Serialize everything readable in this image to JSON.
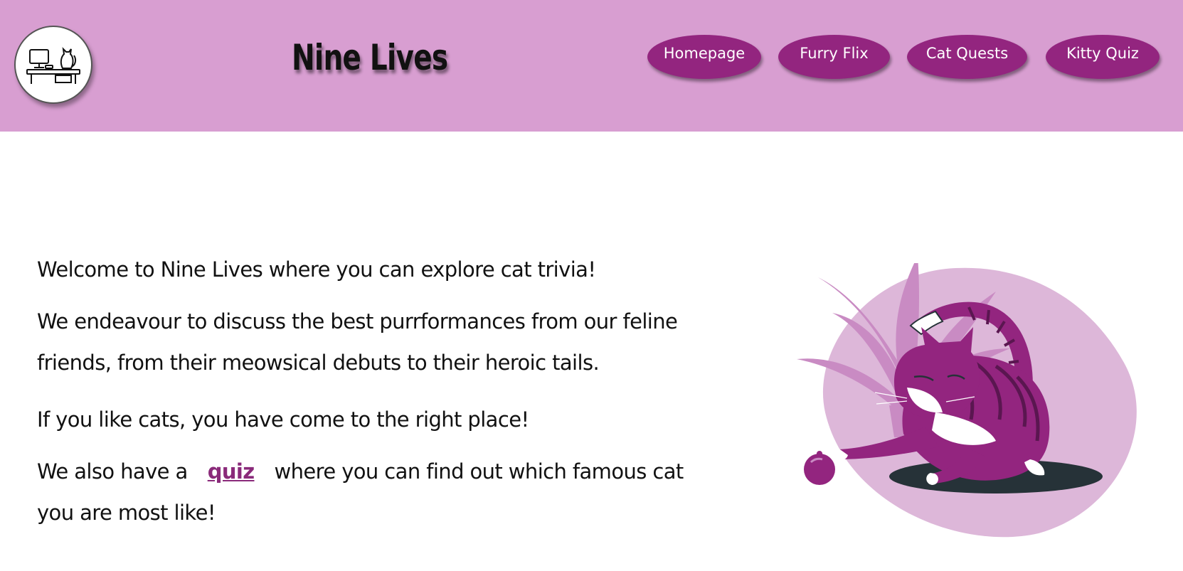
{
  "site": {
    "title": "Nine Lives"
  },
  "nav": [
    {
      "label": "Homepage"
    },
    {
      "label": "Furry Flix"
    },
    {
      "label": "Cat Quests"
    },
    {
      "label": "Kitty Quiz"
    }
  ],
  "main": {
    "welcome": "Welcome to Nine Lives where you can explore cat trivia!",
    "intro": "We endeavour to discuss the best purrformances from our feline friends, from their meowsical debuts to their heroic tails.",
    "cta": "If you like cats, you have come to the right place!",
    "quiz_prefix": "We also have a",
    "quiz_link": "quiz",
    "quiz_suffix": "where you can find out which famous cat you are most like!"
  },
  "colors": {
    "header_bg": "#d89ed1",
    "nav_bg": "#93257f",
    "accent": "#8a2a7a"
  },
  "icons": {
    "logo": "cat-at-desk-icon",
    "hero": "playing-cat-illustration"
  }
}
